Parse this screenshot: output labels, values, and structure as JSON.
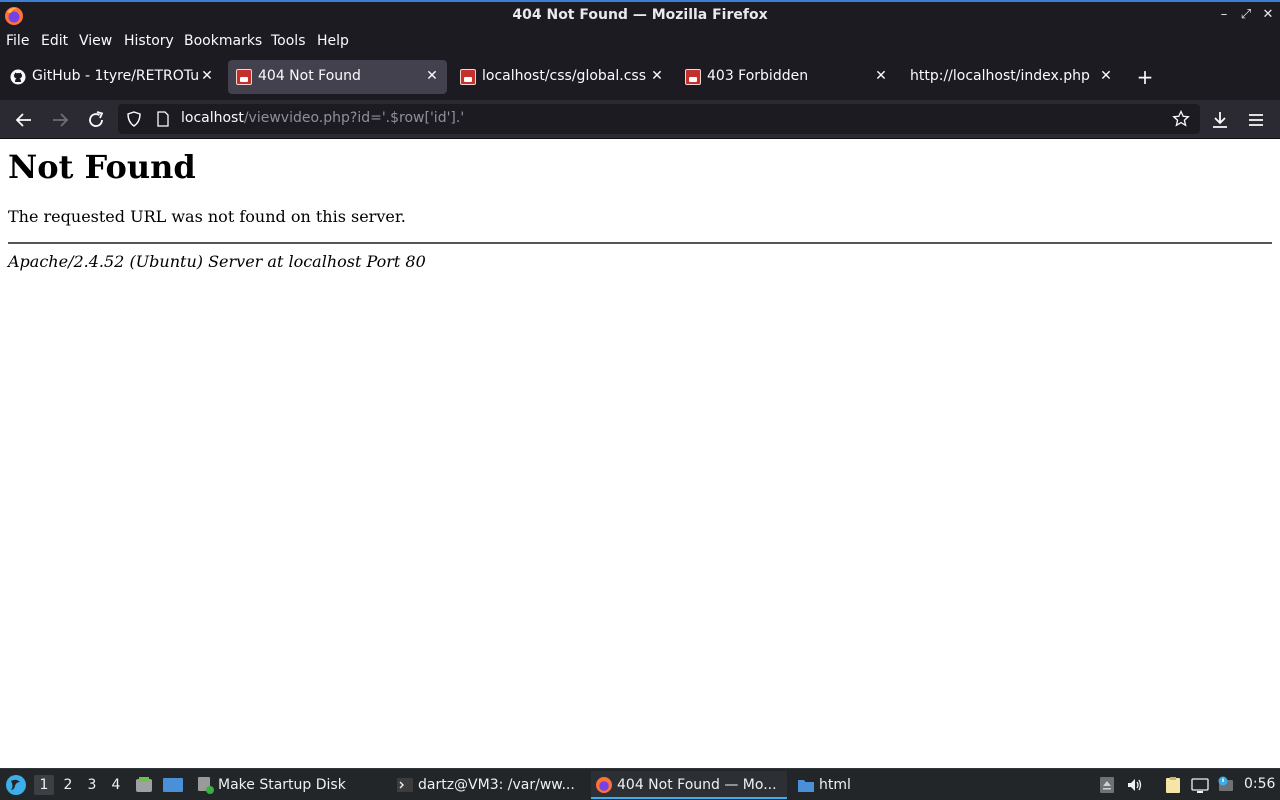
{
  "window": {
    "title": "404 Not Found — Mozilla Firefox"
  },
  "menubar": {
    "items": [
      "File",
      "Edit",
      "View",
      "History",
      "Bookmarks",
      "Tools",
      "Help"
    ]
  },
  "tabs": [
    {
      "label": "GitHub - 1tyre/RETROTub",
      "favicon": "github-icon",
      "active": false
    },
    {
      "label": "404 Not Found",
      "favicon": "retrotube-icon",
      "active": true
    },
    {
      "label": "localhost/css/global.css",
      "favicon": "retrotube-icon",
      "active": false
    },
    {
      "label": "403 Forbidden",
      "favicon": "retrotube-icon",
      "active": false
    },
    {
      "label": "http://localhost/index.php",
      "favicon": "none",
      "active": false
    }
  ],
  "urlbar": {
    "host": "localhost",
    "path": "/viewvideo.php?id='.$row['id'].'"
  },
  "page": {
    "heading": "Not Found",
    "message": "The requested URL was not found on this server.",
    "server_signature": "Apache/2.4.52 (Ubuntu) Server at localhost Port 80"
  },
  "taskbar": {
    "workspaces": [
      "1",
      "2",
      "3",
      "4"
    ],
    "active_workspace": "1",
    "tasks": [
      {
        "label": "Make Startup Disk",
        "icon": "startup-disk-icon"
      },
      {
        "label": "dartz@VM3: /var/ww...",
        "icon": "terminal-icon"
      },
      {
        "label": "404 Not Found — Mo...",
        "icon": "firefox-icon",
        "active": true
      },
      {
        "label": "html",
        "icon": "folder-icon"
      }
    ],
    "clock": "0:56"
  },
  "colors": {
    "chrome_dark": "#1c1b22",
    "toolbar": "#2b2a33",
    "active_tab": "#42414d",
    "taskbar": "#232629",
    "accent": "#3daee9"
  }
}
